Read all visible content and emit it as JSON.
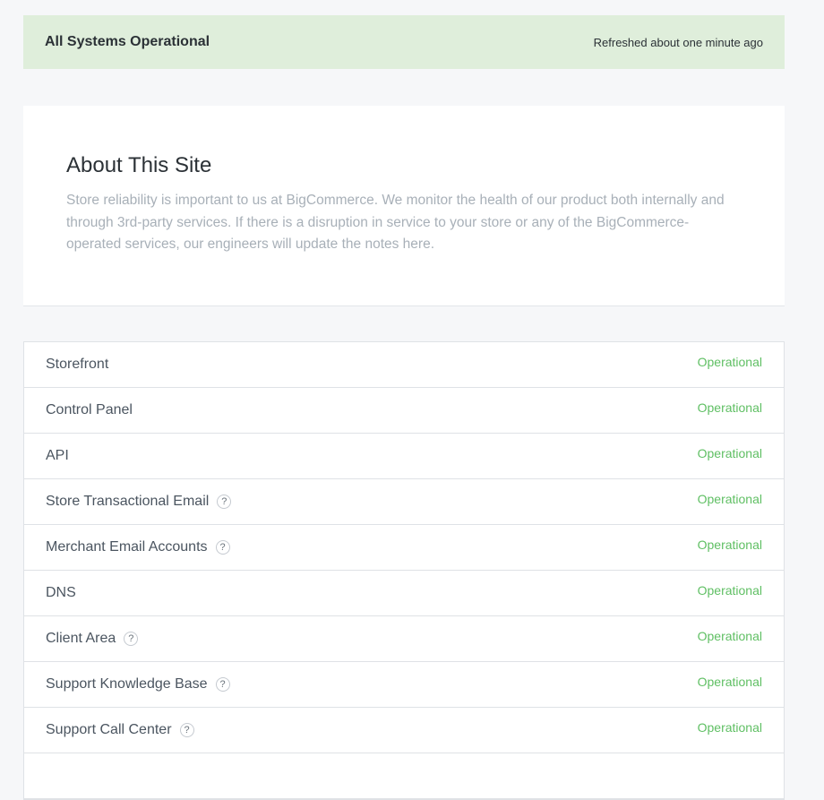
{
  "banner": {
    "title": "All Systems Operational",
    "refreshed": "Refreshed about one minute ago",
    "color": "#dfeedb"
  },
  "about": {
    "title": "About This Site",
    "body": "Store reliability is important to us at BigCommerce. We monitor the health of our product both internally and through 3rd-party services. If there is a disruption in service to your store or any of the BigCommerce-operated services, our engineers will update the notes here."
  },
  "components": [
    {
      "name": "Storefront",
      "status": "Operational",
      "help": false
    },
    {
      "name": "Control Panel",
      "status": "Operational",
      "help": false
    },
    {
      "name": "API",
      "status": "Operational",
      "help": false
    },
    {
      "name": "Store Transactional Email",
      "status": "Operational",
      "help": true
    },
    {
      "name": "Merchant Email Accounts",
      "status": "Operational",
      "help": true
    },
    {
      "name": "DNS",
      "status": "Operational",
      "help": false
    },
    {
      "name": "Client Area",
      "status": "Operational",
      "help": true
    },
    {
      "name": "Support Knowledge Base",
      "status": "Operational",
      "help": true
    },
    {
      "name": "Support Call Center",
      "status": "Operational",
      "help": true
    }
  ],
  "help_icon_glyph": "?",
  "status_color": "#5fbf63"
}
